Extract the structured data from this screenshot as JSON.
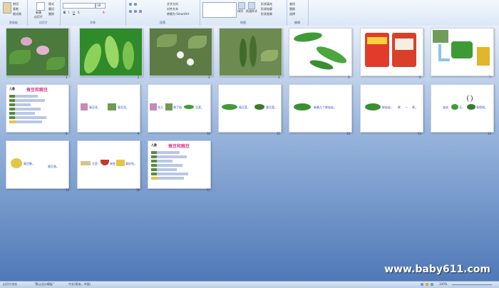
{
  "ribbon": {
    "groups": [
      {
        "name": "clipboard",
        "label": "剪贴板"
      },
      {
        "name": "slides",
        "label": "幻灯片"
      },
      {
        "name": "font",
        "label": "字体"
      },
      {
        "name": "paragraph",
        "label": "段落"
      },
      {
        "name": "drawing",
        "label": "绘图"
      },
      {
        "name": "editing",
        "label": "编辑"
      }
    ],
    "clipboard_items": [
      "剪切",
      "复制",
      "格式刷"
    ],
    "slides_items": [
      "新建",
      "幻灯片",
      "版式",
      "重设",
      "删除"
    ],
    "font_size": "18",
    "paragraph_items": [
      "文字方向",
      "对齐文本",
      "转换为 SmartArt"
    ],
    "drawing_items": [
      "排列",
      "快速样式",
      "形状填充",
      "形状轮廓",
      "形状效果"
    ],
    "editing_items": [
      "查找",
      "替换",
      "选择"
    ]
  },
  "slides": [
    {
      "n": "1",
      "type": "flower-photo"
    },
    {
      "n": "2",
      "type": "pods-photo"
    },
    {
      "n": "3",
      "type": "bush-photo"
    },
    {
      "n": "4",
      "type": "pods-hanging-photo"
    },
    {
      "n": "5",
      "type": "pods-white"
    },
    {
      "n": "6",
      "type": "snack-bags"
    },
    {
      "n": "7",
      "type": "combo"
    },
    {
      "n": "8",
      "type": "poem",
      "title": "蚕豆和豌豆",
      "tag": "儿歌"
    },
    {
      "n": "9",
      "type": "text",
      "text_a": "豌豆花，",
      "text_b": "蚕豆花。"
    },
    {
      "n": "10",
      "type": "text",
      "text_a": "花儿",
      "text_b": "谢了结",
      "text_c": "豆荚。"
    },
    {
      "n": "11",
      "type": "text",
      "text_a": "豌豆荚，",
      "text_b": "蚕豆荚。"
    },
    {
      "n": "12",
      "type": "text",
      "text_a": "剥着几个胖娃娃。"
    },
    {
      "n": "13",
      "type": "text",
      "text_a": "胖娃娃，",
      "text_b": "煮",
      "text_c": "一",
      "text_d": "煮，"
    },
    {
      "n": "14",
      "type": "text",
      "text_a": "变成",
      "text_b": "豆，",
      "text_c": "香喷喷。"
    },
    {
      "n": "15",
      "type": "text",
      "text_a": "豌豆酥，",
      "text_b": "蚕豆香。"
    },
    {
      "n": "16",
      "type": "text",
      "text_a": "大家",
      "text_b": "来尝",
      "text_c": "真好吃。"
    },
    {
      "n": "17",
      "type": "poem",
      "title": "蚕豆和豌豆",
      "tag": "儿歌"
    }
  ],
  "statusbar": {
    "view": "幻灯片浏览",
    "theme": "\"默认设计模板\"",
    "lang": "中文(简体，中国)",
    "zoom": "100%"
  },
  "watermark": "www.baby611.com"
}
